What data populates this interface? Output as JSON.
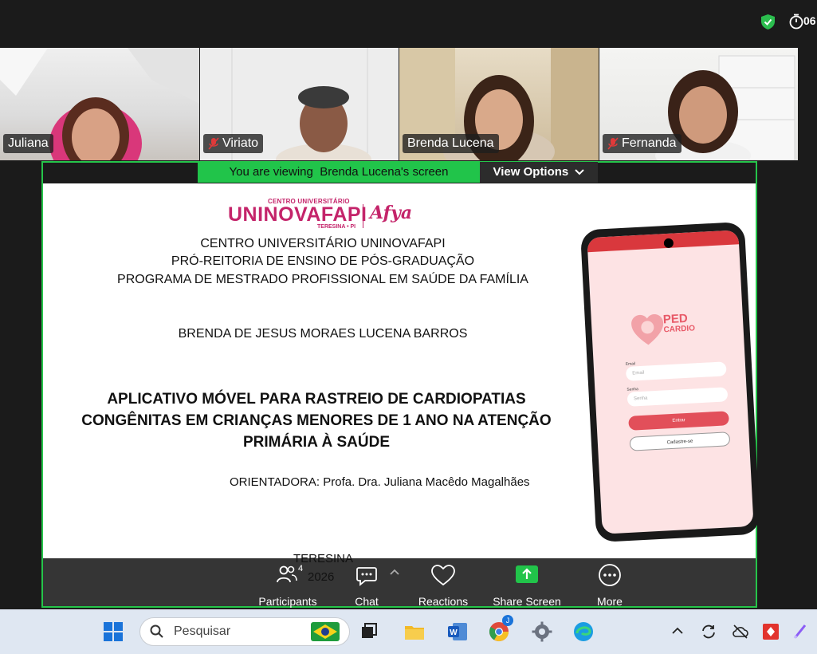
{
  "status": {
    "timer": "06"
  },
  "participants_tiles": [
    {
      "name": "Juliana",
      "muted": false
    },
    {
      "name": "Viriato",
      "muted": true
    },
    {
      "name": "Brenda Lucena",
      "muted": false
    },
    {
      "name": "Fernanda",
      "muted": true
    }
  ],
  "share_banner": {
    "viewing": "You are viewing",
    "presenter": "Brenda Lucena's screen",
    "view_options": "View Options"
  },
  "slide": {
    "logo_top": "CENTRO UNIVERSITÁRIO",
    "logo_main": "UNINOVAFAPI",
    "logo_city": "TERESINA • PI",
    "logo_partner": "Afya",
    "institution": "CENTRO UNIVERSITÁRIO UNINOVAFAPI",
    "dept": "PRÓ-REITORIA DE ENSINO DE PÓS-GRADUAÇÃO",
    "program": "PROGRAMA DE MESTRADO PROFISSIONAL EM SAÚDE DA FAMÍLIA",
    "author": "BRENDA  DE JESUS MORAES LUCENA BARROS",
    "title_line1": "APLICATIVO MÓVEL PARA RASTREIO DE CARDIOPATIAS",
    "title_line2": "CONGÊNITAS EM CRIANÇAS MENORES DE 1 ANO NA ATENÇÃO",
    "title_line3": "PRIMÁRIA À SAÚDE",
    "advisor": "ORIENTADORA: Profa. Dra. Juliana Macêdo Magalhães",
    "city": "TERESINA",
    "year": "2026"
  },
  "phone_app": {
    "logo_ped": "PED",
    "logo_cardio": "CARDIO",
    "email_label": "Email",
    "email_placeholder": "Email",
    "password_label": "Senha",
    "password_placeholder": "Senha",
    "login_button": "Entrar",
    "register_button": "Cadastre-se"
  },
  "controls": {
    "participants_count": "4",
    "participants": "Participants",
    "chat": "Chat",
    "reactions": "Reactions",
    "share_screen": "Share Screen",
    "more": "More"
  },
  "taskbar": {
    "search_placeholder": "Pesquisar"
  },
  "colors": {
    "accent_green": "#21c44a",
    "brand_pink": "#c4246a",
    "app_red": "#e24f5a"
  }
}
